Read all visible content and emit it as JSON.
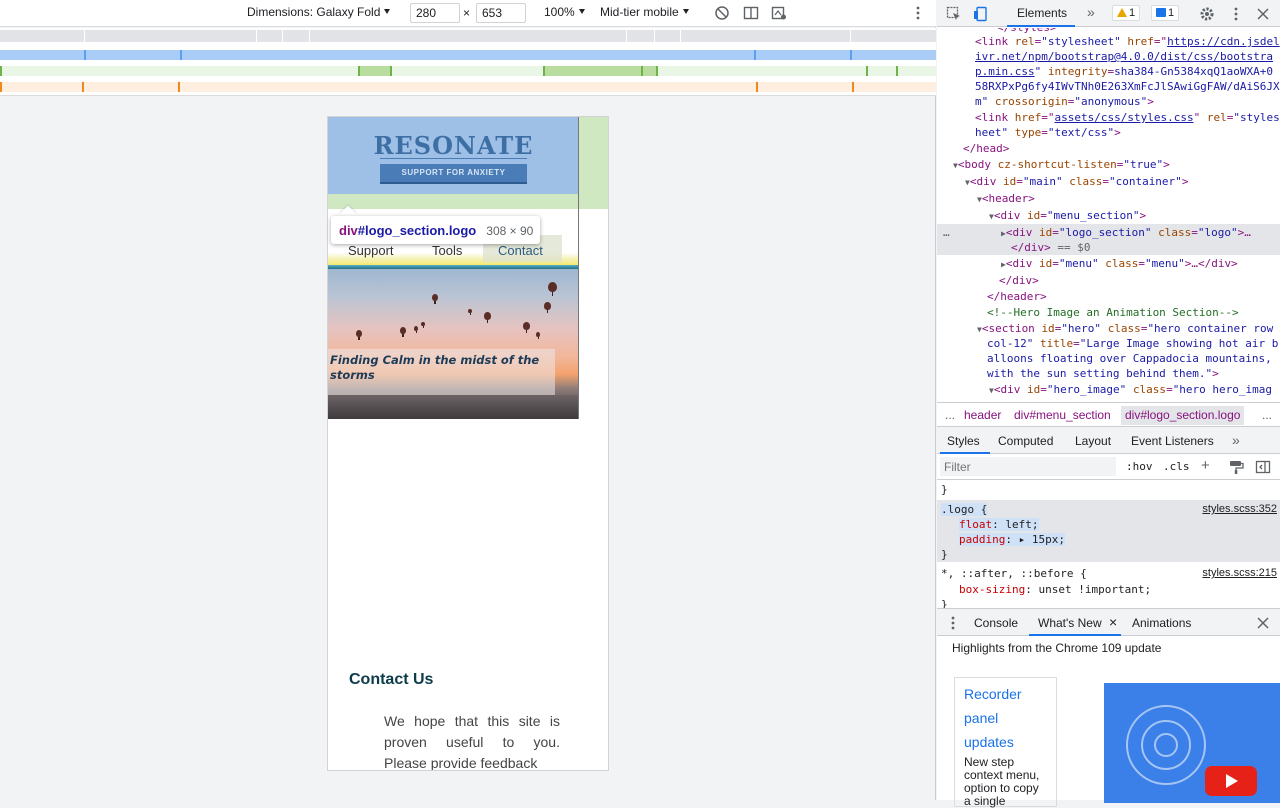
{
  "toolbar": {
    "dimensions_label": "Dimensions: Galaxy Fold",
    "width": "280",
    "height": "653",
    "times": "×",
    "zoom": "100%",
    "throttle": "Mid-tier mobile"
  },
  "page": {
    "logo_title": "RESONATE",
    "logo_subtitle": "SUPPORT FOR ANXIETY",
    "menu": [
      "Support",
      "Tools",
      "Contact"
    ],
    "hero_caption": "Finding Calm in the midst of the storms",
    "contact_title": "Contact Us",
    "contact_text": "We hope that this site is proven useful to you. Please provide feedback"
  },
  "tooltip": {
    "tag": "div",
    "selector": "#logo_section.logo",
    "size": "308 × 90"
  },
  "devtools": {
    "tabs": {
      "elements": "Elements",
      "more": "»",
      "warnings": "1",
      "messages": "1"
    },
    "dom": {
      "line0_tail": "styles",
      "link1_href_a": "https://cdn.jsdel",
      "link1_href_b": "ivr.net/npm/bootstrap@4.0.0/dist/css/bootstra",
      "link1_href_c": "p.min.css",
      "link1_integrity_a": "sha384-Gn5384xqQ1aoWXA+0",
      "link1_integrity_b": "58RXPxPg6fy4IWvTNh0E263XmFcJlSAwiGgFAW/dAiS6JX",
      "link1_integrity_c": "m\"",
      "link2_href": "assets/css/styles.css",
      "comment": "<!--Hero Image an Animation Section-->",
      "hero_title_a": "\"Large Image showing hot air b",
      "hero_title_b": "alloons floating over Cappadocia mountains,",
      "hero_title_c": "with the sun setting behind them.\"",
      "dollar0": "== $0"
    },
    "breadcrumbs": [
      "...",
      "header",
      "div#menu_section",
      "div#logo_section.logo",
      "..."
    ],
    "styles_tabs": [
      "Styles",
      "Computed",
      "Layout",
      "Event Listeners",
      "»"
    ],
    "filter_placeholder": "Filter",
    "filter_buttons": [
      ":hov",
      ".cls",
      "+"
    ],
    "rules": {
      "logo_selector": ".logo {",
      "logo_src": "styles.scss:352",
      "float_prop": "float",
      "float_val": "left;",
      "padding_prop": "padding",
      "padding_val": "15px;",
      "universal_selector": "*, ::after, ::before {",
      "universal_src": "styles.scss:215",
      "box_prop": "box-sizing",
      "box_val": "unset !important;"
    },
    "drawer_tabs": [
      "Console",
      "What's New",
      "Animations"
    ],
    "whats_new_heading": "Highlights from the Chrome 109 update",
    "card_title": "Recorder panel updates",
    "card_desc": "New step context menu, option to copy a single"
  },
  "colors": {
    "logo_blue": "#3d6fa5",
    "menu_active": "#2f5d7e",
    "devtools_accent": "#1a73e8",
    "tag_purple": "#881280"
  }
}
